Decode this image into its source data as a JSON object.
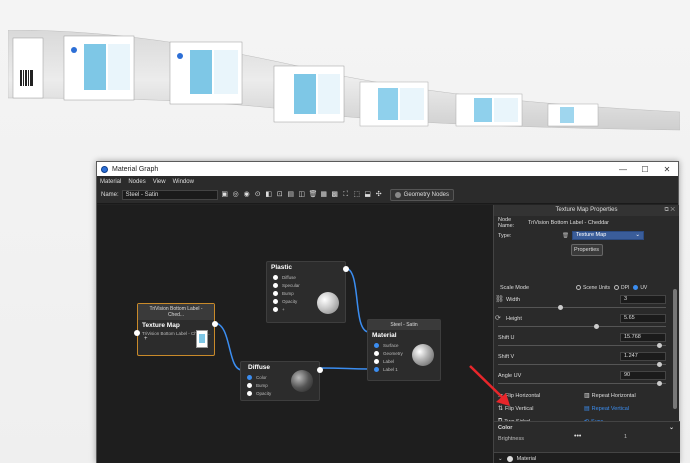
{
  "window": {
    "title": "Material Graph",
    "controls": [
      "—",
      "☐",
      "✕"
    ]
  },
  "menu": [
    "Material",
    "Nodes",
    "View",
    "Window"
  ],
  "toolbar": {
    "name_label": "Name:",
    "name_value": "Steel - Satin",
    "geometry_button": "Geometry Nodes"
  },
  "nodes": {
    "texture_map": {
      "header": "TriVision Bottom Label - Ched...",
      "title": "Texture Map",
      "subtitle": "TriVision Bottom Label - Chedda...",
      "extra": "+"
    },
    "plastic": {
      "title": "Plastic",
      "ports": [
        "Diffuse",
        "Specular",
        "Bump",
        "Opacity",
        "+"
      ]
    },
    "diffuse": {
      "title": "Diffuse",
      "ports": [
        "Color",
        "Bump",
        "Opacity"
      ]
    },
    "material": {
      "header": "Steel - Satin",
      "title": "Material",
      "ports": [
        "Surface",
        "Geometry",
        "Label",
        "Label 1"
      ]
    }
  },
  "panel": {
    "title": "Texture Map Properties",
    "node_name_label": "Node Name:",
    "node_name_value": "TriVision Bottom Label - Cheddar",
    "type_label": "Type:",
    "type_value": "Texture Map",
    "properties_button": "Properties",
    "scale_mode_label": "Scale Mode",
    "scale_modes": [
      "Scene Units",
      "DPI",
      "UV"
    ],
    "fields": [
      {
        "label": "Width",
        "value": "3"
      },
      {
        "label": "Height",
        "value": "5.65"
      },
      {
        "label": "Shift U",
        "value": "15.768"
      },
      {
        "label": "Shift V",
        "value": "1.247"
      },
      {
        "label": "Angle UV",
        "value": "90"
      }
    ],
    "toggles": {
      "flip_horizontal": "Flip Horizontal",
      "repeat_horizontal": "Repeat Horizontal",
      "flip_vertical": "Flip Vertical",
      "repeat_vertical": "Repeat Vertical",
      "two_sided": "Two Sided",
      "sync": "Sync"
    },
    "color_section": "Color",
    "brightness_label": "Brightness",
    "brightness_value": "1",
    "material_bar": "Material"
  },
  "colors": {
    "accent": "#3b8df0",
    "arrow": "#e8262b",
    "wire": "#3b8df0"
  }
}
